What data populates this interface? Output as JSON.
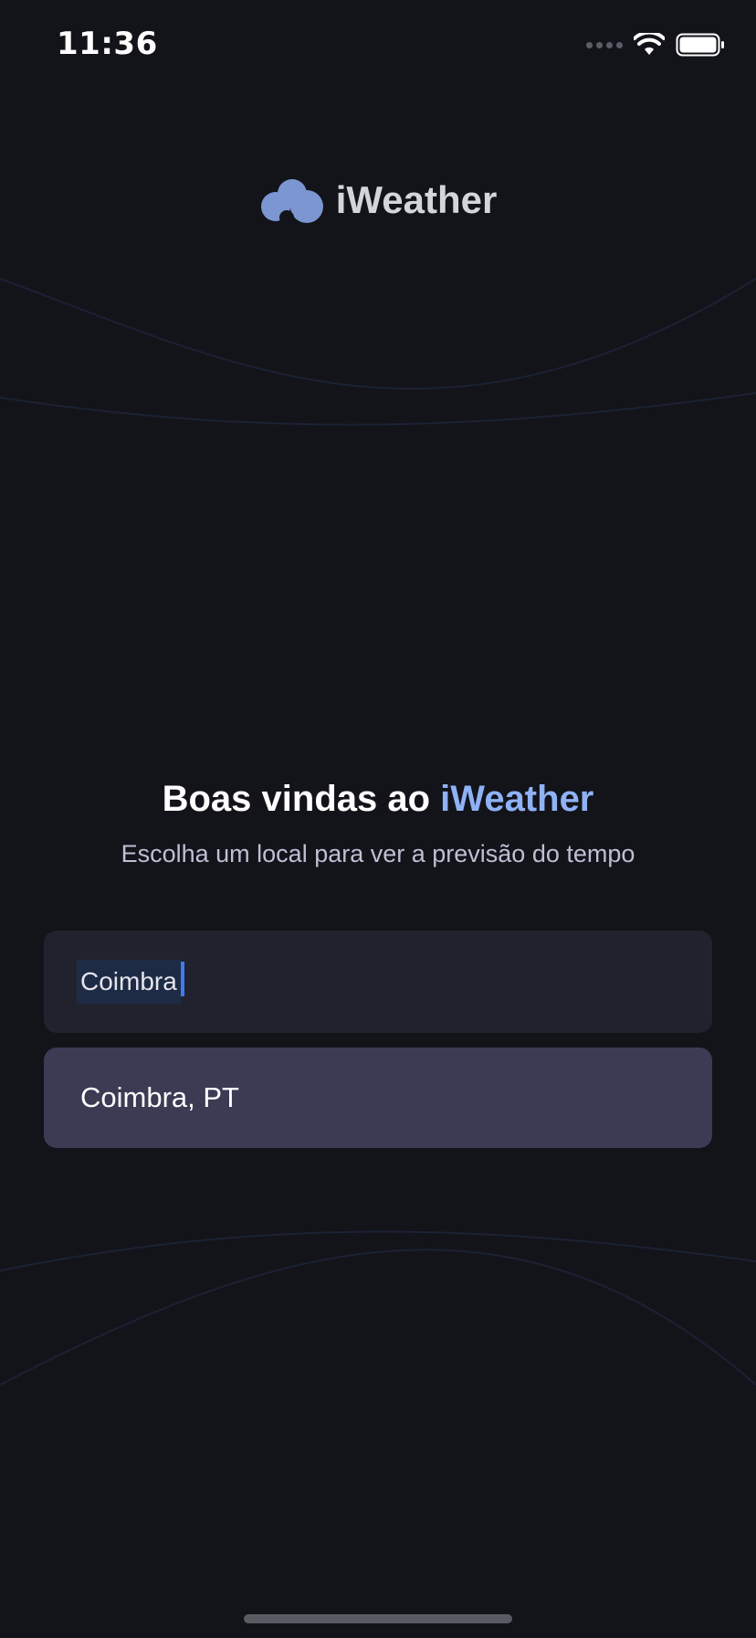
{
  "status_bar": {
    "time": "11:36"
  },
  "logo": {
    "text": "iWeather",
    "icon": "cloud-icon",
    "icon_color": "#7B96D1"
  },
  "welcome": {
    "title_prefix": "Boas vindas ao ",
    "title_brand": "iWeather",
    "subtitle": "Escolha um local para ver a previsão do tempo"
  },
  "search": {
    "value": "Coimbra"
  },
  "suggestions": [
    {
      "label": "Coimbra, PT"
    }
  ],
  "colors": {
    "background": "#13131A",
    "brand_accent": "#8FB2F5",
    "input_bg": "#22222F",
    "suggestion_bg": "#3B3B54",
    "caret": "#3E7BF0"
  }
}
